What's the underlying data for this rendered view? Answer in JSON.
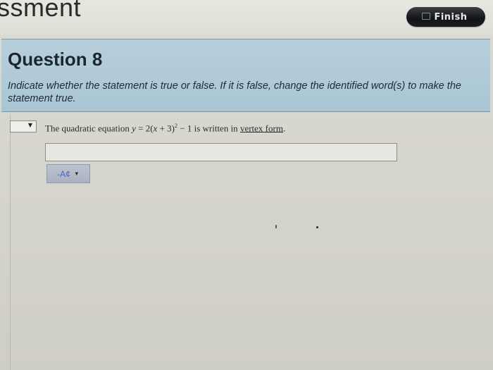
{
  "header": {
    "title": "ssment",
    "finish_label": "Finish"
  },
  "question": {
    "title": "Question 8",
    "instructions": "Indicate whether the statement is true or false. If it is false, change the identified word(s) to make the statement true."
  },
  "answer": {
    "selected": "",
    "arrow": "▼"
  },
  "statement": {
    "prefix": "The quadratic equation ",
    "var_y": "y",
    "eq_part1": " = 2(",
    "var_x": "x",
    "eq_part2": " + 3)",
    "exponent": "2",
    "eq_part3": " − 1 is written in ",
    "identified_words": "vertex form",
    "suffix": "."
  },
  "correction": {
    "value": "",
    "placeholder": ""
  },
  "format_button": {
    "label": "-A¢",
    "caret": "▼"
  },
  "colors": {
    "header_band": "#b7cfdb",
    "finish_button": "#1b1d20",
    "format_text": "#4a62c8"
  }
}
